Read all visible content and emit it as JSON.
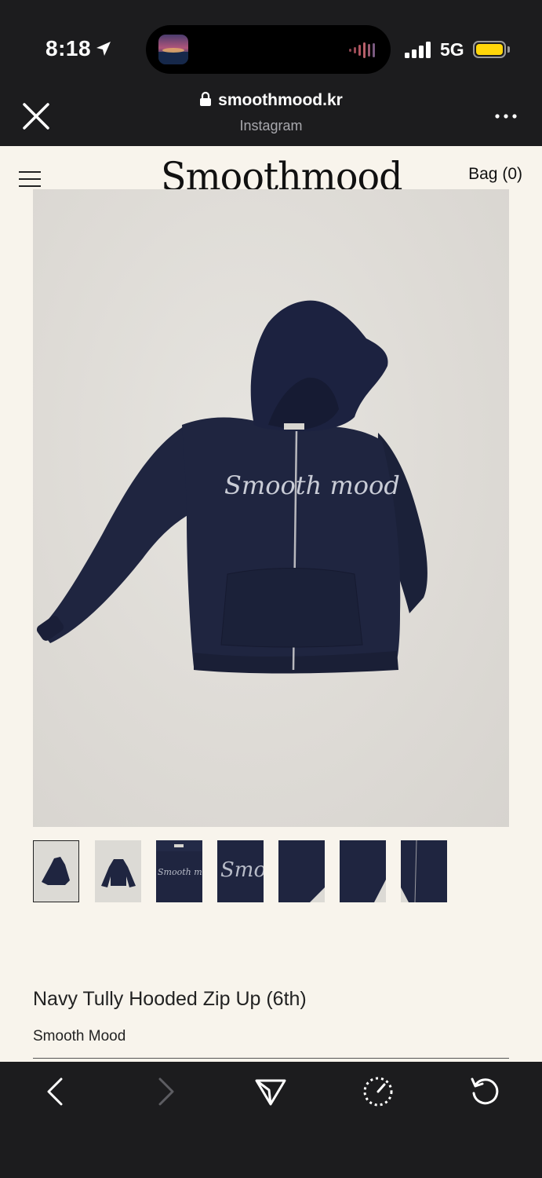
{
  "status_bar": {
    "time": "8:18",
    "network": "5G",
    "icons": [
      "location-arrow-icon",
      "audio-wave-icon",
      "signal-bars-icon",
      "battery-icon"
    ],
    "battery_color": "#ffd60a"
  },
  "browser": {
    "url": "smoothmood.kr",
    "subtitle": "Instagram",
    "icons": [
      "close-icon",
      "lock-icon",
      "more-icon"
    ]
  },
  "site": {
    "logo": "Smoothmood",
    "bag_label": "Bag (0)",
    "background": "#f8f4ec"
  },
  "product": {
    "title": "Navy Tully Hooded Zip Up (6th)",
    "brand": "Smooth Mood",
    "chest_text": "Smooth mood",
    "hoodie_color": "#1f2540",
    "thumbnail_count": 7,
    "selected_thumbnail": 1
  },
  "toolbar": {
    "icons": [
      "back-icon",
      "forward-icon",
      "share-icon",
      "speed-icon",
      "reload-icon"
    ]
  }
}
